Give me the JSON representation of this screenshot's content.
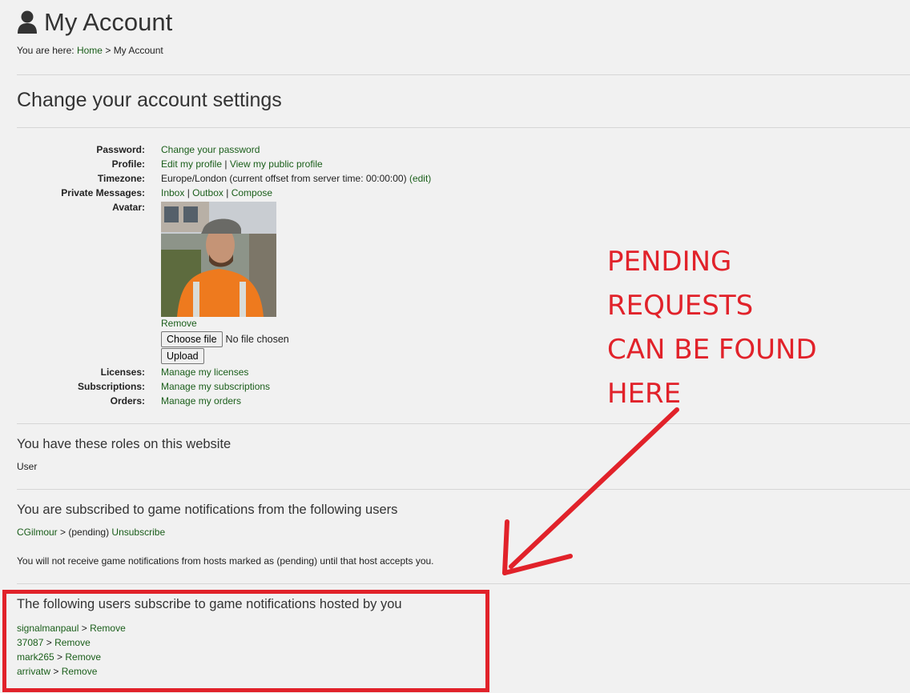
{
  "header": {
    "title": "My Account",
    "breadcrumb_prefix": "You are here:",
    "breadcrumb_home": "Home",
    "breadcrumb_sep": ">",
    "breadcrumb_current": "My Account"
  },
  "settings": {
    "heading": "Change your account settings",
    "password_label": "Password:",
    "password_link": "Change your password",
    "profile_label": "Profile:",
    "profile_edit": "Edit my profile",
    "profile_sep": "|",
    "profile_view": "View my public profile",
    "timezone_label": "Timezone:",
    "timezone_value": "Europe/London (current offset from server time: 00:00:00)",
    "timezone_edit": "(edit)",
    "pm_label": "Private Messages:",
    "pm_inbox": "Inbox",
    "pm_outbox": "Outbox",
    "pm_compose": "Compose",
    "pm_sep": "|",
    "avatar_label": "Avatar:",
    "avatar_remove": "Remove",
    "choose_file_label": "Choose file",
    "no_file_text": "No file chosen",
    "upload_label": "Upload",
    "licenses_label": "Licenses:",
    "licenses_link": "Manage my licenses",
    "subscriptions_label": "Subscriptions:",
    "subscriptions_link": "Manage my subscriptions",
    "orders_label": "Orders:",
    "orders_link": "Manage my orders"
  },
  "roles": {
    "heading": "You have these roles on this website",
    "role": "User"
  },
  "subscribed": {
    "heading": "You are subscribed to game notifications from the following users",
    "user": "CGilmour",
    "sep": ">",
    "status": "(pending)",
    "unsubscribe": "Unsubscribe",
    "note": "You will not receive game notifications from hosts marked as (pending) until that host accepts you."
  },
  "subscribers": {
    "heading": "The following users subscribe to game notifications hosted by you",
    "sep": ">",
    "remove": "Remove",
    "users": [
      "signalmanpaul",
      "37087",
      "mark265",
      "arrivatw"
    ]
  },
  "annotation": {
    "line1": "PENDING",
    "line2": "REQUESTS",
    "line3": "CAN BE FOUND",
    "line4": "HERE",
    "color": "#e1222a"
  },
  "colors": {
    "link": "#1a5e1a",
    "background": "#f1f1f1"
  }
}
